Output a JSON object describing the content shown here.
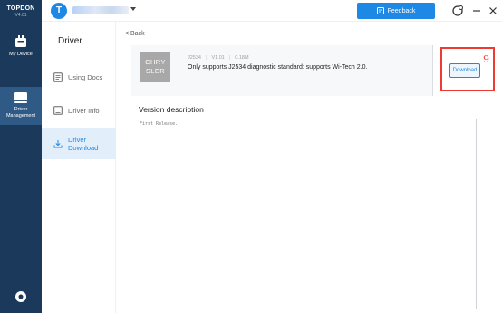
{
  "brand": {
    "name": "TOPDON",
    "version": "V4.01"
  },
  "rail": {
    "items": [
      {
        "label": "My Device",
        "icon": "device-icon",
        "active": false
      },
      {
        "label": "Driver Management",
        "icon": "driver-management-icon",
        "active": true
      }
    ],
    "settings_icon": "gear-icon"
  },
  "topbar": {
    "avatar_letter": "T",
    "feedback_label": "Feedback",
    "icons": [
      "help-icon",
      "minimize-icon",
      "close-icon"
    ],
    "accent": "#1e88e5"
  },
  "subnav": {
    "title": "Driver",
    "items": [
      {
        "label": "Using Docs",
        "icon": "docs-icon",
        "active": false
      },
      {
        "label": "Driver Info",
        "icon": "info-icon",
        "active": false
      },
      {
        "label": "Driver Download",
        "icon": "download-icon",
        "active": true
      }
    ]
  },
  "main": {
    "back_label": "< Back",
    "driver": {
      "logo_line1": "CHRY",
      "logo_line2": "SLER",
      "standard": "J2534",
      "version": "V1.01",
      "size": "0.18M",
      "description": "Only supports J2534 diagnostic standard: supports Wi-Tech 2.0."
    },
    "download_label": "Download",
    "step_number": "9",
    "version_title": "Version description",
    "version_body": "First Release."
  },
  "colors": {
    "rail": "#1b3a5b",
    "rail_active": "#2f5a86",
    "highlight": "#ee3b32"
  }
}
